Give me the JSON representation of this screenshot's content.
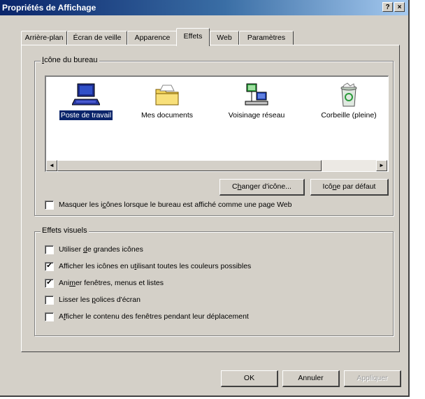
{
  "window": {
    "title": "Propriétés de Affichage",
    "help_button": "?",
    "close_button": "×"
  },
  "tabs": [
    {
      "label": "Arrière-plan",
      "active": false
    },
    {
      "label": "Écran de veille",
      "active": false
    },
    {
      "label": "Apparence",
      "active": false
    },
    {
      "label": "Effets",
      "active": true
    },
    {
      "label": "Web",
      "active": false
    },
    {
      "label": "Paramètres",
      "active": false
    }
  ],
  "desktop_icons_group": {
    "label_access": "I",
    "label_rest": "cône du bureau",
    "icons": [
      {
        "label": "Poste de travail",
        "icon": "computer-icon",
        "selected": true
      },
      {
        "label": "Mes documents",
        "icon": "folder-icon",
        "selected": false
      },
      {
        "label": "Voisinage réseau",
        "icon": "network-icon",
        "selected": false
      },
      {
        "label": "Corbeille (pleine)",
        "icon": "recycle-bin-full-icon",
        "selected": false
      }
    ],
    "scroll_left": "◄",
    "scroll_right": "►",
    "change_icon_pre": "C",
    "change_icon_access": "h",
    "change_icon_post": "anger d'icône...",
    "default_icon_pre": "Icô",
    "default_icon_access": "n",
    "default_icon_post": "e par défaut",
    "hide_icons_pre": "Masquer les i",
    "hide_icons_access": "c",
    "hide_icons_post": "ônes lorsque le bureau est affiché comme une page Web",
    "hide_icons_checked": false
  },
  "visual_effects_group": {
    "label": "Effets visuels",
    "options": [
      {
        "pre": "Utiliser ",
        "access": "d",
        "post": "e grandes icônes",
        "checked": false
      },
      {
        "pre": "Afficher les icônes en u",
        "access": "t",
        "post": "ilisant toutes les couleurs possibles",
        "checked": true
      },
      {
        "pre": "Ani",
        "access": "m",
        "post": "er fenêtres, menus et listes",
        "checked": true
      },
      {
        "pre": "Lisser les ",
        "access": "p",
        "post": "olices d'écran",
        "checked": false
      },
      {
        "pre": "A",
        "access": "f",
        "post": "ficher le contenu des fenêtres pendant leur déplacement",
        "checked": false
      }
    ]
  },
  "footer": {
    "ok": "OK",
    "cancel": "Annuler",
    "apply": "Appliquer"
  },
  "check_mark": "✔",
  "colors": {
    "title_start": "#0a246a",
    "title_end": "#a6caf0",
    "face": "#d4d0c8",
    "selection": "#0a246a"
  }
}
